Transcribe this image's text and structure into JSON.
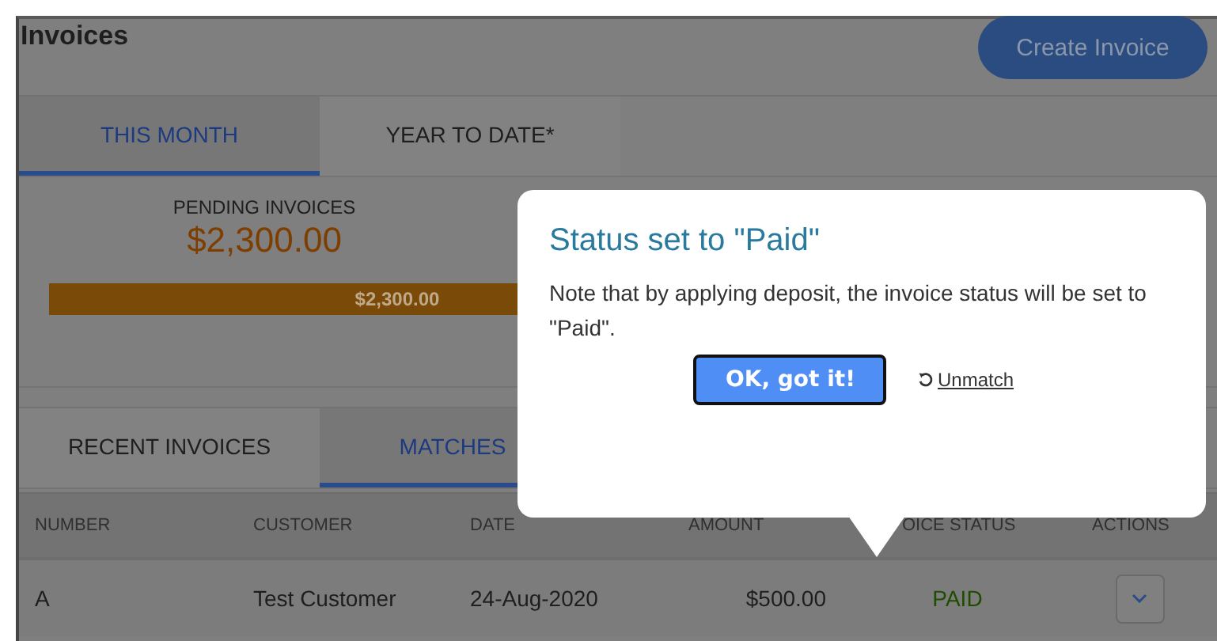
{
  "header": {
    "title": "Invoices",
    "create_button": "Create Invoice"
  },
  "period_tabs": [
    {
      "label": "THIS MONTH",
      "selected": true
    },
    {
      "label": "YEAR TO DATE*",
      "selected": false
    }
  ],
  "summary": {
    "label": "PENDING INVOICES",
    "amount": "$2,300.00",
    "bar_label": "$2,300.00"
  },
  "list_tabs": [
    {
      "label": "RECENT INVOICES",
      "selected": false
    },
    {
      "label": "MATCHES",
      "selected": true
    }
  ],
  "table": {
    "columns": [
      "NUMBER",
      "CUSTOMER",
      "DATE",
      "AMOUNT",
      "OICE STATUS",
      "ACTIONS"
    ],
    "rows": [
      {
        "cells": [
          "A",
          "Test Customer",
          "24-Aug-2020",
          "$500.00",
          "PAID"
        ]
      }
    ]
  },
  "popover": {
    "title": "Status set to \"Paid\"",
    "message": "Note that by applying deposit, the invoice status will be set to \"Paid\".",
    "confirm_button": "OK, got it!",
    "unmatch_link": "Unmatch"
  }
}
